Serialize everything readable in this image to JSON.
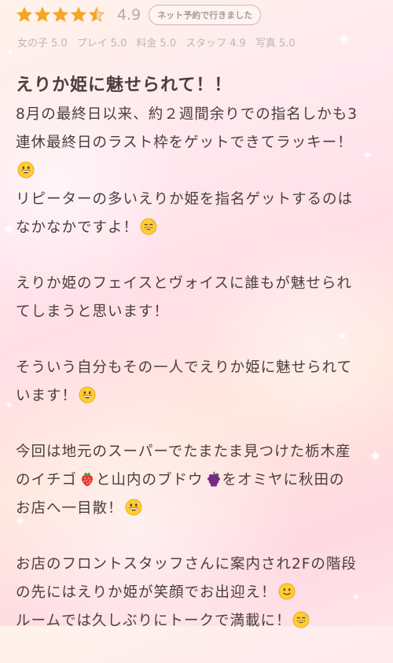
{
  "review": {
    "rating": {
      "stars_filled": 4.5,
      "stars_total": 5,
      "value": "4.9",
      "star_color": "#f5a623",
      "star_empty_color": "#e8d5d0"
    },
    "reservation_badge": "ネット予約で行きました",
    "scores": [
      {
        "label": "女の子",
        "value": "5.0"
      },
      {
        "label": "プレイ",
        "value": "5.0"
      },
      {
        "label": "料金",
        "value": "5.0"
      },
      {
        "label": "スタッフ",
        "value": "4.9"
      },
      {
        "label": "写真",
        "value": "5.0"
      }
    ],
    "title": "えりか姫に魅せられて！！",
    "paragraphs": [
      {
        "lines": [
          {
            "text": "8月の最終日以来、約２週間余りでの指名しかも3"
          },
          {
            "text": "連休最終日のラスト枠をゲットできてラッキー！"
          },
          {
            "text": "",
            "emoji": "grinning-face-icon"
          },
          {
            "text": "リピーターの多いえりか姫を指名ゲットするのは"
          },
          {
            "text": "なかなかですよ！",
            "emoji": "grinning-sweat-icon"
          }
        ]
      },
      {
        "lines": [
          {
            "text": "えりか姫のフェイスとヴォイスに誰もが魅せられ"
          },
          {
            "text": "てしまうと思います！"
          }
        ]
      },
      {
        "lines": [
          {
            "text": "そういう自分もその一人でえりか姫に魅せられて"
          },
          {
            "text": "います！",
            "emoji": "grinning-face-icon"
          }
        ]
      },
      {
        "lines": [
          {
            "text": "今回は地元のスーパーでたまたま見つけた栃木産"
          },
          {
            "text": "のイチゴ",
            "emoji": "strawberry-icon",
            "after": "と山内のブドウ",
            "emoji2": "grapes-icon",
            "after2": "をオミヤに秋田の"
          },
          {
            "text": "お店へ一目散！",
            "emoji": "grinning-face-icon"
          }
        ]
      },
      {
        "lines": [
          {
            "text": "お店のフロントスタッフさんに案内され2Fの階段"
          },
          {
            "text": "の先にはえりか姫が笑顔でお出迎え！",
            "emoji": "slightly-smiling-icon"
          },
          {
            "text": "ルームでは久しぶりにトークで満載に！",
            "emoji": "grinning-sweat-icon"
          }
        ]
      }
    ]
  }
}
